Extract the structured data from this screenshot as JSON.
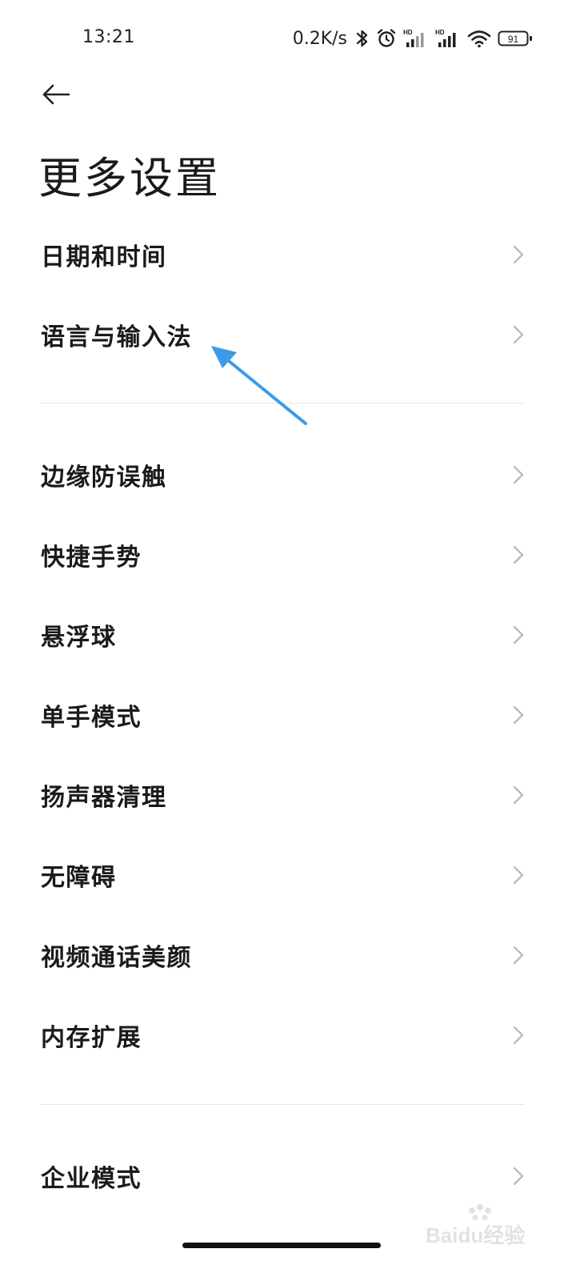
{
  "status_bar": {
    "time": "13:21",
    "net_speed": "0.2K/s",
    "sim1_badge": "HD",
    "sim2_badge": "HD",
    "battery": "91"
  },
  "header": {
    "title": "更多设置"
  },
  "settings": {
    "items": [
      {
        "label": "日期和时间"
      },
      {
        "label": "语言与输入法"
      },
      {
        "label": "边缘防误触"
      },
      {
        "label": "快捷手势"
      },
      {
        "label": "悬浮球"
      },
      {
        "label": "单手模式"
      },
      {
        "label": "扬声器清理"
      },
      {
        "label": "无障碍"
      },
      {
        "label": "视频通话美颜"
      },
      {
        "label": "内存扩展"
      },
      {
        "label": "企业模式"
      }
    ]
  },
  "annotation": {
    "arrow_color": "#3b9be8"
  },
  "watermark": {
    "text": "Baidu经验"
  }
}
